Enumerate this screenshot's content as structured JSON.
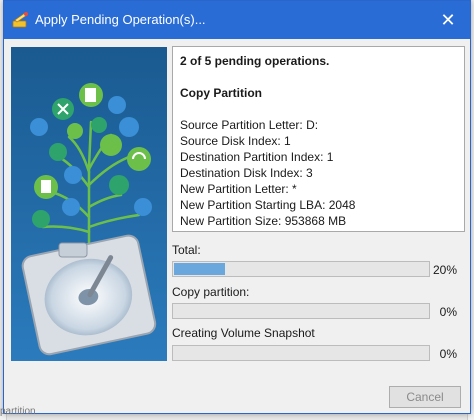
{
  "window": {
    "title": "Apply Pending Operation(s)..."
  },
  "info": {
    "status": "2 of 5 pending operations.",
    "operation": "Copy Partition",
    "details": [
      "Source Partition Letter: D:",
      "Source Disk Index: 1",
      "Destination Partition Index: 1",
      "Destination Disk Index: 3",
      "New Partition Letter: *",
      "New Partition Starting LBA: 2048",
      "New Partition Size: 953868 MB"
    ]
  },
  "progress": [
    {
      "label": "Total:",
      "percent_text": "20%",
      "value": 20
    },
    {
      "label": "Copy partition:",
      "percent_text": "0%",
      "value": 0
    },
    {
      "label": "Creating Volume Snapshot",
      "percent_text": "0%",
      "value": 0
    }
  ],
  "buttons": {
    "cancel": "Cancel"
  },
  "background": {
    "bottom_text": "partition"
  },
  "colors": {
    "titlebar": "#2a6cd6",
    "progress_fill": "#6aa7dc",
    "illustration_bg": "#1d5f96"
  }
}
